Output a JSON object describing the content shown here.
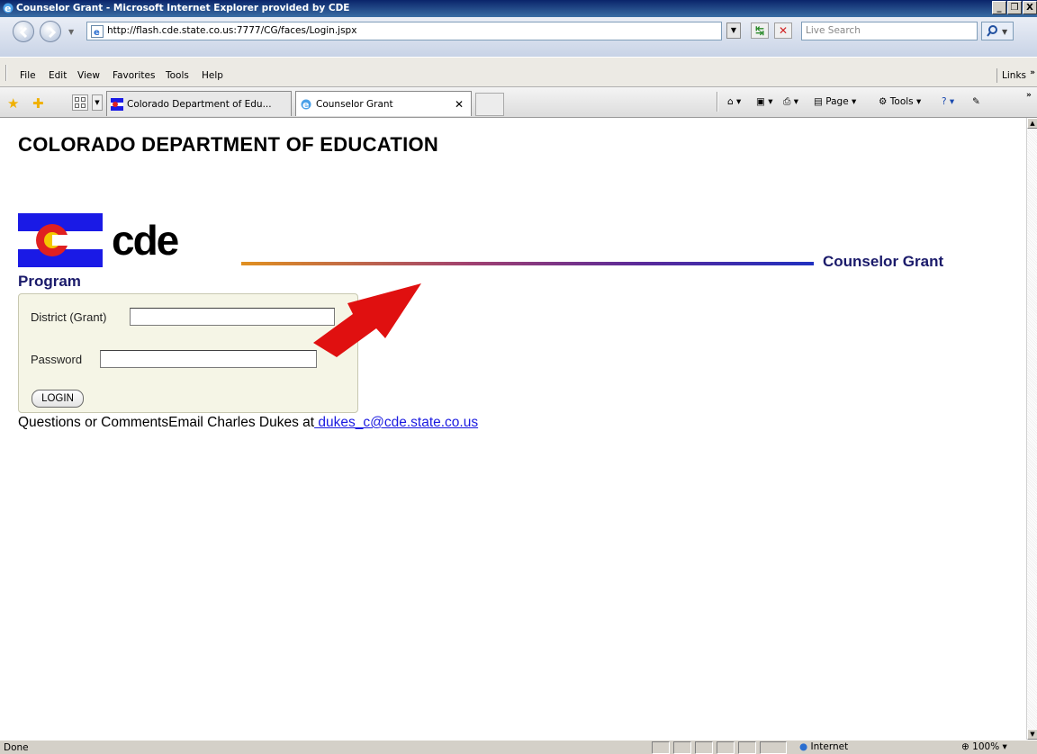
{
  "window": {
    "title": "Counselor Grant - Microsoft Internet Explorer provided by CDE",
    "buttons": [
      "_",
      "❒",
      "X"
    ]
  },
  "address_bar": {
    "url": "http://flash.cde.state.co.us:7777/CG/faces/Login.jspx",
    "search_placeholder": "Live Search"
  },
  "menu": {
    "items": [
      "File",
      "Edit",
      "View",
      "Favorites",
      "Tools",
      "Help"
    ],
    "links_label": "Links"
  },
  "tabs": [
    {
      "label": "Colorado Department of Edu...",
      "active": false
    },
    {
      "label": "Counselor Grant",
      "active": true
    }
  ],
  "command_bar": {
    "page_label": "Page",
    "tools_label": "Tools"
  },
  "page": {
    "header": "COLORADO DEPARTMENT OF EDUCATION",
    "logo_text": "cde",
    "app_name_part1": "Counselor Grant",
    "app_name_part2": "Program",
    "district_label": "District (Grant)",
    "district_value": "",
    "password_label": "Password",
    "password_value": "",
    "login_button": "LOGIN",
    "footer_text": "Questions or CommentsEmail Charles Dukes at",
    "footer_email": " dukes_c@cde.state.co.us"
  },
  "status_bar": {
    "status": "Done",
    "zone": "Internet",
    "zoom": "100%"
  },
  "colors": {
    "title_bar": "#0a246a",
    "program_text": "#1a1a6a",
    "link": "#1a1ae0",
    "arrow": "#e01010",
    "flag_blue": "#1a1ae6",
    "flag_red": "#e02020",
    "flag_gold": "#f4c800"
  }
}
